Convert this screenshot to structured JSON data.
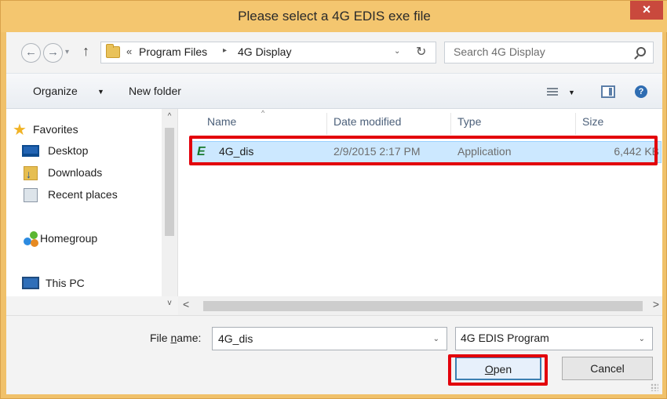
{
  "window": {
    "title": "Please select a 4G EDIS exe file",
    "close_glyph": "×"
  },
  "navigation": {
    "back_glyph": "←",
    "forward_glyph": "→",
    "recent_dropdown_glyph": "▾",
    "up_glyph": "↑",
    "breadcrumb_overflow": "«",
    "breadcrumbs": [
      "Program Files",
      "4G Display"
    ],
    "breadcrumb_separator": "▸",
    "address_dropdown_glyph": "⌄",
    "refresh_glyph": "↻",
    "search_placeholder": "Search 4G Display"
  },
  "toolbar": {
    "organize_label": "Organize",
    "organize_arrow": "▼",
    "new_folder_label": "New folder",
    "view_dropdown_glyph": "▼",
    "help_glyph": "?"
  },
  "sidebar": {
    "items": [
      {
        "label": "Favorites",
        "icon": "star-icon"
      },
      {
        "label": "Desktop",
        "icon": "desktop-icon"
      },
      {
        "label": "Downloads",
        "icon": "downloads-icon"
      },
      {
        "label": "Recent places",
        "icon": "recent-places-icon"
      },
      {
        "label": "Homegroup",
        "icon": "homegroup-icon"
      },
      {
        "label": "This PC",
        "icon": "this-pc-icon"
      }
    ],
    "scroll_up_glyph": "^",
    "scroll_down_glyph": "v"
  },
  "file_list": {
    "sort_indicator": "^",
    "columns": [
      "Name",
      "Date modified",
      "Type",
      "Size"
    ],
    "rows": [
      {
        "icon_glyph": "E",
        "name": "4G_dis",
        "date_modified": "2/9/2015 2:17 PM",
        "type": "Application",
        "size": "6,442 KB"
      }
    ],
    "scroll_left_glyph": "<",
    "scroll_right_glyph": ">"
  },
  "bottom": {
    "file_name_label_prefix": "File ",
    "file_name_label_mnemonic": "n",
    "file_name_label_suffix": "ame:",
    "file_name_value": "4G_dis",
    "file_name_dropdown_glyph": "⌄",
    "file_type_value": "4G EDIS Program",
    "file_type_dropdown_glyph": "⌄",
    "open_mnemonic": "O",
    "open_rest": "pen",
    "cancel_label": "Cancel"
  },
  "colors": {
    "titlebar": "#f4c66f",
    "close_button": "#c9493d",
    "selection": "#cce8ff",
    "annotation_highlight": "#e3000b"
  }
}
